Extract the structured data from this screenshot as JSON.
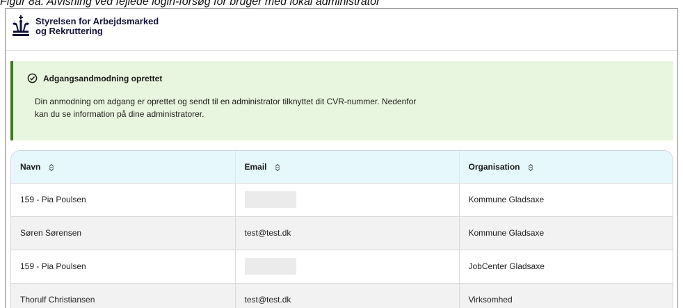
{
  "caption": "Figur 8a: Afvisning ved fejlede login-forsøg for bruger med lokal administrator",
  "header": {
    "org_line1": "Styrelsen for Arbejdsmarked",
    "org_line2": "og Rekruttering",
    "logo_icon": "crown-icon"
  },
  "alert": {
    "icon": "check-circle-icon",
    "title": "Adgangsandmodning oprettet",
    "body": "Din anmodning om adgang er oprettet og sendt til en administrator tilknyttet dit CVR-nummer. Nedenfor kan du se information på dine administratorer.",
    "accent": "#3c7a1e",
    "background": "#e9f6df"
  },
  "table": {
    "headers": [
      "Navn",
      "Email",
      "Organisation"
    ],
    "sort_icon": "sort-icon",
    "rows": [
      {
        "name": "159 - Pia Poulsen",
        "email": "",
        "org": "Kommune Gladsaxe"
      },
      {
        "name": "Søren Sørensen",
        "email": "test@test.dk",
        "org": "Kommune Gladsaxe"
      },
      {
        "name": "159 - Pia Poulsen",
        "email": "",
        "org": "JobCenter Gladsaxe"
      },
      {
        "name": "Thorulf Christiansen",
        "email": "test@test.dk",
        "org": "Virksomhed"
      }
    ]
  },
  "colors": {
    "header_row": "#e6f8fb",
    "brand_text": "#14143c"
  }
}
